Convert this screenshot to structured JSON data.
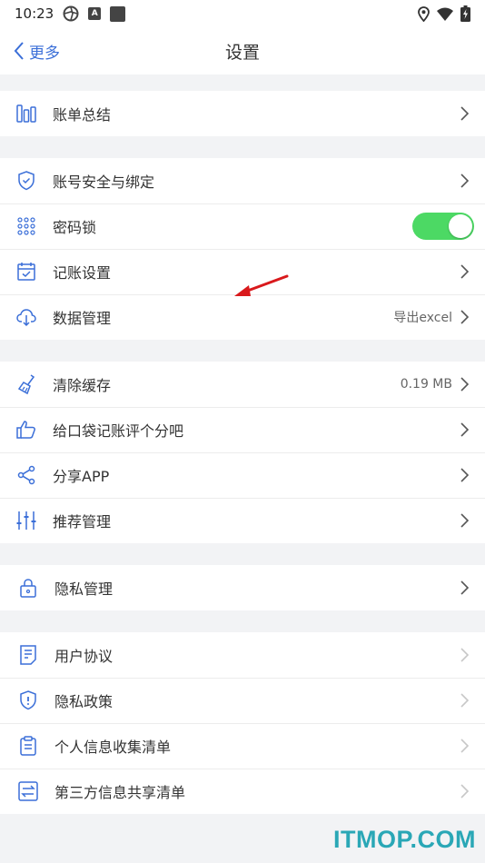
{
  "status_bar": {
    "time": "10:23",
    "icon_a": "A"
  },
  "nav": {
    "back_label": "更多",
    "title": "设置"
  },
  "groups": [
    {
      "items": [
        {
          "label": "账单总结",
          "icon": "bar-chart-icon"
        }
      ]
    },
    {
      "items": [
        {
          "label": "账号安全与绑定",
          "icon": "shield-check-icon"
        },
        {
          "label": "密码锁",
          "icon": "dot-grid-icon",
          "toggle": true
        },
        {
          "label": "记账设置",
          "icon": "calendar-check-icon"
        },
        {
          "label": "数据管理",
          "icon": "cloud-download-icon",
          "value": "导出excel"
        }
      ]
    },
    {
      "items": [
        {
          "label": "清除缓存",
          "icon": "brush-icon",
          "value": "0.19 MB"
        },
        {
          "label": "给口袋记账评个分吧",
          "icon": "thumbs-up-icon"
        },
        {
          "label": "分享APP",
          "icon": "share-icon"
        },
        {
          "label": "推荐管理",
          "icon": "sliders-icon"
        }
      ]
    },
    {
      "items": [
        {
          "label": "隐私管理",
          "icon": "lock-icon"
        }
      ]
    },
    {
      "items": [
        {
          "label": "用户协议",
          "icon": "document-icon"
        },
        {
          "label": "隐私政策",
          "icon": "shield-info-icon"
        },
        {
          "label": "个人信息收集清单",
          "icon": "clipboard-icon"
        },
        {
          "label": "第三方信息共享清单",
          "icon": "exchange-icon"
        }
      ]
    }
  ],
  "watermark": "ITMOP.COM",
  "colors": {
    "accent": "#3b6fd8",
    "toggle_on": "#4cd964",
    "watermark": "#2aa7b6"
  }
}
